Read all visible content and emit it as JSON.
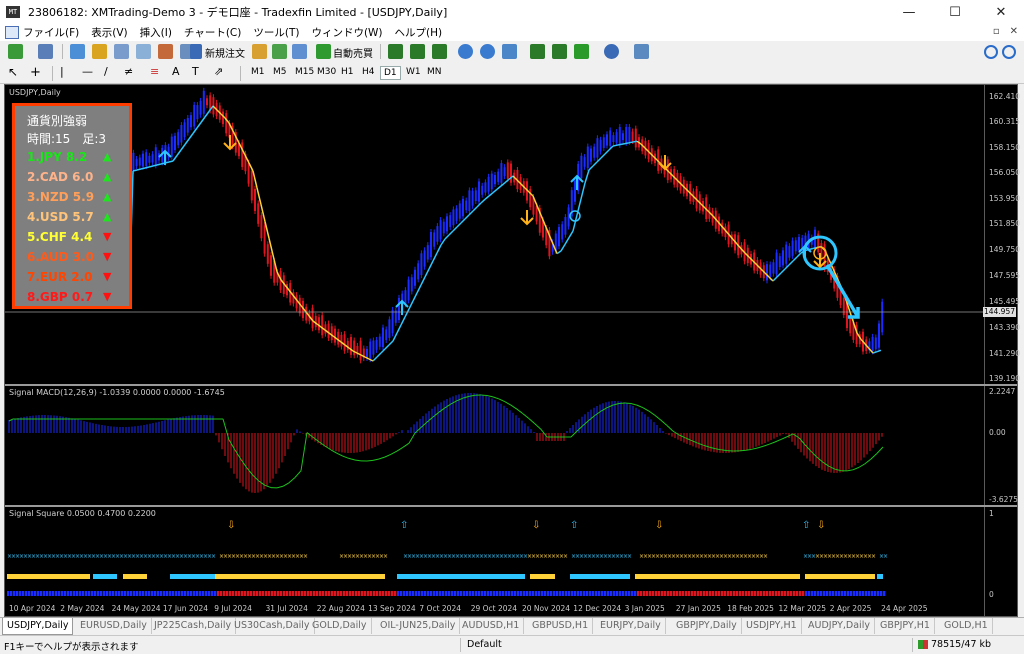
{
  "window": {
    "title": "23806182: XMTrading-Demo 3 - デモ口座 - Tradexfin Limited - [USDJPY,Daily]",
    "min": "—",
    "max": "☐",
    "close": "✕"
  },
  "menu": {
    "items": [
      "ファイル(F)",
      "表示(V)",
      "挿入(I)",
      "チャート(C)",
      "ツール(T)",
      "ウィンドウ(W)",
      "ヘルプ(H)"
    ],
    "restore": "▫",
    "close": "✕"
  },
  "toolbar": {
    "new_order": "新規注文",
    "autotrading": "自動売買"
  },
  "timeframes": [
    "M1",
    "M5",
    "M15",
    "M30",
    "H1",
    "H4",
    "D1",
    "W1",
    "MN"
  ],
  "active_timeframe": "D1",
  "chart": {
    "symbol_label": "USDJPY,Daily",
    "current_price": "144.957",
    "price_ticks": [
      "162.410",
      "160.315",
      "158.150",
      "156.050",
      "153.950",
      "151.850",
      "149.750",
      "147.595",
      "145.495",
      "143.390",
      "141.290",
      "139.190"
    ],
    "panel": {
      "title": "通貨別強弱",
      "info": "時間:15　足:3",
      "rows": [
        {
          "label": "1.JPY  8.2",
          "dir": "up",
          "color": "#19e619"
        },
        {
          "label": "2.CAD  6.0",
          "dir": "up",
          "color": "#ffb38a"
        },
        {
          "label": "3.NZD  5.9",
          "dir": "up",
          "color": "#ff9f5a"
        },
        {
          "label": "4.USD  5.7",
          "dir": "up",
          "color": "#ffc37a"
        },
        {
          "label": "5.CHF  4.4",
          "dir": "down",
          "color": "#ffff33"
        },
        {
          "label": "6.AUD  3.0",
          "dir": "down",
          "color": "#ff5a1a"
        },
        {
          "label": "7.EUR  2.0",
          "dir": "down",
          "color": "#ff4500"
        },
        {
          "label": "8.GBP  0.7",
          "dir": "down",
          "color": "#ff1a1a"
        }
      ],
      "up_symbol": "▲",
      "down_symbol": "▼",
      "up_color": "#1fe41f",
      "down_color": "#ff1111"
    },
    "macd": {
      "label": "Signal MACD(12,26,9) -1.0339 0.0000 0.0000 -1.6745",
      "ticks": [
        "2.2247",
        "0.00",
        "-3.6275"
      ]
    },
    "square": {
      "label": "Signal Square 0.0500 0.4700 0.2200",
      "ticks": [
        "1",
        "0"
      ]
    },
    "dates": [
      "10 Apr 2024",
      "2 May 2024",
      "24 May 2024",
      "17 Jun 2024",
      "9 Jul 2024",
      "31 Jul 2024",
      "22 Aug 2024",
      "13 Sep 2024",
      "7 Oct 2024",
      "29 Oct 2024",
      "20 Nov 2024",
      "12 Dec 2024",
      "3 Jan 2025",
      "27 Jan 2025",
      "18 Feb 2025",
      "12 Mar 2025",
      "2 Apr 2025",
      "24 Apr 2025"
    ]
  },
  "tabs": [
    "USDJPY,Daily",
    "EURUSD,Daily",
    "JP225Cash,Daily",
    "US30Cash,Daily",
    "GOLD,Daily",
    "OIL-JUN25,Daily",
    "AUDUSD,H1",
    "GBPUSD,H1",
    "EURJPY,Daily",
    "GBPJPY,Daily",
    "USDJPY,H1",
    "AUDJPY,Daily",
    "GBPJPY,H1",
    "GOLD,H1"
  ],
  "status": {
    "help": "F1キーでヘルプが表示されます",
    "profile": "Default",
    "traffic": "78515/47 kb"
  },
  "colors": {
    "bull": "#1a2cff",
    "bear": "#e0141e",
    "ma_up": "#2fc6ff",
    "ma_down": "#ffd23a",
    "macd_signal": "#1dc11d",
    "arrow": "#2fc6ff",
    "arrow_down": "#ffb21a"
  }
}
